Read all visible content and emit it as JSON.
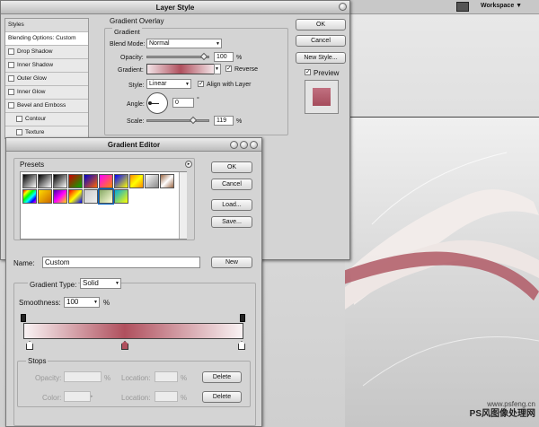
{
  "topbar": {
    "workspace_label": "Workspace ▼"
  },
  "layer_style": {
    "title": "Layer Style",
    "styles_header": "Styles",
    "styles_list": [
      "Blending Options: Custom",
      "Drop Shadow",
      "Inner Shadow",
      "Outer Glow",
      "Inner Glow",
      "Bevel and Emboss",
      "Contour",
      "Texture"
    ],
    "styles_checked": [
      false,
      false,
      false,
      false,
      false,
      false,
      false
    ],
    "section_title": "Gradient Overlay",
    "sub_title": "Gradient",
    "blend_mode_label": "Blend Mode:",
    "blend_mode_value": "Normal",
    "opacity_label": "Opacity:",
    "opacity_value": "100",
    "opacity_unit": "%",
    "gradient_label": "Gradient:",
    "reverse_label": "Reverse",
    "reverse_checked": true,
    "style_label": "Style:",
    "style_value": "Linear",
    "align_label": "Align with Layer",
    "align_checked": true,
    "angle_label": "Angle:",
    "angle_value": "0",
    "angle_unit": "°",
    "scale_label": "Scale:",
    "scale_value": "119",
    "scale_unit": "%",
    "ok_label": "OK",
    "cancel_label": "Cancel",
    "new_style_label": "New Style...",
    "preview_label": "Preview",
    "preview_checked": true
  },
  "gradient_editor": {
    "title": "Gradient Editor",
    "presets_label": "Presets",
    "ok_label": "OK",
    "cancel_label": "Cancel",
    "load_label": "Load...",
    "save_label": "Save...",
    "name_label": "Name:",
    "name_value": "Custom",
    "new_label": "New",
    "type_label": "Gradient Type:",
    "type_value": "Solid",
    "smoothness_label": "Smoothness:",
    "smoothness_value": "100",
    "smoothness_unit": "%",
    "stops_label": "Stops",
    "opacity_label": "Opacity:",
    "opacity_unit": "%",
    "location_label": "Location:",
    "location_unit": "%",
    "color_label": "Color:",
    "delete_label": "Delete"
  },
  "colors": {
    "gradient_mid": "#b0505e",
    "gradient_end": "#f7eef0",
    "preview": "#b86070"
  },
  "watermark": {
    "line1": "www.psfeng.cn",
    "line2": "PS风图像处理网"
  }
}
